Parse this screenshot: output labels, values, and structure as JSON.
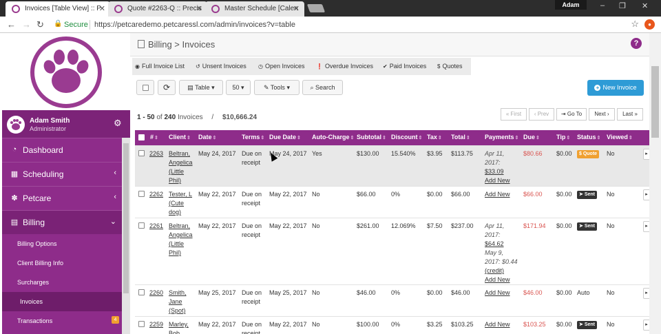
{
  "browser": {
    "tabs": [
      {
        "title": "Invoices [Table View] :: P",
        "active": true
      },
      {
        "title": "Quote #2263-Q :: Precis",
        "active": false
      },
      {
        "title": "Master Schedule [Calen",
        "active": false
      }
    ],
    "profile_name": "Adam",
    "secure_label": "Secure",
    "url": "https://petcaredemo.petcaressl.com/admin/invoices?v=table"
  },
  "sidebar": {
    "user_name": "Adam Smith",
    "user_role": "Administrator",
    "menu": [
      {
        "label": "Dashboard",
        "icon": "dashboard-icon"
      },
      {
        "label": "Scheduling",
        "icon": "calendar-icon"
      },
      {
        "label": "Petcare",
        "icon": "paw-icon"
      },
      {
        "label": "Billing",
        "icon": "document-icon"
      }
    ],
    "submenu": [
      {
        "label": "Billing Options"
      },
      {
        "label": "Client Billing Info"
      },
      {
        "label": "Surcharges"
      },
      {
        "label": "Invoices"
      },
      {
        "label": "Transactions",
        "badge": "4"
      }
    ]
  },
  "header": {
    "breadcrumb": "Billing > Invoices",
    "help": "?"
  },
  "filters": [
    {
      "label": "Full Invoice List",
      "icon": "globe-icon"
    },
    {
      "label": "Unsent Invoices",
      "icon": "undo-icon"
    },
    {
      "label": "Open Invoices",
      "icon": "clock-icon"
    },
    {
      "label": "Overdue Invoices",
      "icon": "exclamation-icon"
    },
    {
      "label": "Paid Invoices",
      "icon": "check-circle-icon"
    },
    {
      "label": "Quotes",
      "icon": "dollar-icon"
    }
  ],
  "toolbar": {
    "view": "Table",
    "per_page": "50",
    "tools": "Tools",
    "search": "Search",
    "new_invoice": "New Invoice"
  },
  "summary": {
    "range": "1 - 50",
    "of": "of",
    "count": "240",
    "unit": "Invoices",
    "slash": "/",
    "total": "$10,666.24"
  },
  "pager": {
    "first": "« First",
    "prev": "‹ Prev",
    "goto": "Go To",
    "next": "Next ›",
    "last": "Last »"
  },
  "columns": [
    "#",
    "Client",
    "Date",
    "Terms",
    "Due Date",
    "Auto-Charge",
    "Subtotal",
    "Discount",
    "Tax",
    "Total",
    "Payments",
    "Due",
    "Tip",
    "Status",
    "Viewed"
  ],
  "rows": [
    {
      "num": "2263",
      "client": [
        "Beltran,",
        "Angelica",
        "(Little",
        "Phil)"
      ],
      "date": "May 24, 2017",
      "terms": [
        "Due on",
        "receipt"
      ],
      "due_date": "May 24, 2017",
      "auto": "Yes",
      "subtotal": "$130.00",
      "discount": "15.540%",
      "tax": "$3.95",
      "total": "$113.75",
      "payments": [
        {
          "t": "Apr 11,",
          "s": "i"
        },
        {
          "t": "2017:",
          "s": "i"
        },
        {
          "t": "$33.09",
          "s": "u"
        },
        {
          "t": "Add New",
          "s": "u"
        }
      ],
      "due": "$80.66",
      "tip": "$0.00",
      "status": "$ Quote",
      "viewed": "No"
    },
    {
      "num": "2262",
      "client": [
        "Tester, L",
        "(Cute",
        "dog)"
      ],
      "date": "May 22, 2017",
      "terms": [
        "Due on",
        "receipt"
      ],
      "due_date": "May 22, 2017",
      "auto": "No",
      "subtotal": "$66.00",
      "discount": "0%",
      "tax": "$0.00",
      "total": "$66.00",
      "payments": [
        {
          "t": "Add New",
          "s": "u"
        }
      ],
      "due": "$66.00",
      "tip": "$0.00",
      "status": "Sent",
      "viewed": "No"
    },
    {
      "num": "2261",
      "client": [
        "Beltran,",
        "Angelica",
        "(Little",
        "Phil)"
      ],
      "date": "May 22, 2017",
      "terms": [
        "Due on",
        "receipt"
      ],
      "due_date": "May 22, 2017",
      "auto": "No",
      "subtotal": "$261.00",
      "discount": "12.069%",
      "tax": "$7.50",
      "total": "$237.00",
      "payments": [
        {
          "t": "Apr 11,",
          "s": "i"
        },
        {
          "t": "2017:",
          "s": "i"
        },
        {
          "t": "$64.62",
          "s": "u"
        },
        {
          "t": "May 9,",
          "s": "i"
        },
        {
          "t": "2017: $0.44",
          "s": "mix"
        },
        {
          "t": "(credit)",
          "s": "u"
        },
        {
          "t": "Add New",
          "s": "u"
        }
      ],
      "due": "$171.94",
      "tip": "$0.00",
      "status": "Sent",
      "viewed": "No"
    },
    {
      "num": "2260",
      "client": [
        "Smith,",
        "Jane",
        "(Spot)"
      ],
      "date": "May 25, 2017",
      "terms": [
        "Due on",
        "receipt"
      ],
      "due_date": "May 25, 2017",
      "auto": "No",
      "subtotal": "$46.00",
      "discount": "0%",
      "tax": "$0.00",
      "total": "$46.00",
      "payments": [
        {
          "t": "Add New",
          "s": "u"
        }
      ],
      "due": "$46.00",
      "tip": "$0.00",
      "status_text": "Auto",
      "viewed": "No"
    },
    {
      "num": "2259",
      "client": [
        "Marley,",
        "Bob"
      ],
      "date": "May 22, 2017",
      "terms": [
        "Due on",
        "receipt"
      ],
      "due_date": "May 22, 2017",
      "auto": "No",
      "subtotal": "$100.00",
      "discount": "0%",
      "tax": "$3.25",
      "total": "$103.25",
      "payments": [
        {
          "t": "Add New",
          "s": "u"
        }
      ],
      "due": "$103.25",
      "tip": "$0.00",
      "status": "Sent",
      "viewed": "No"
    }
  ],
  "colors": {
    "brand_purple": "#8e2c8a",
    "primary_blue": "#2e9bd6",
    "due_red": "#d9534f",
    "quote_orange": "#f0a030"
  }
}
